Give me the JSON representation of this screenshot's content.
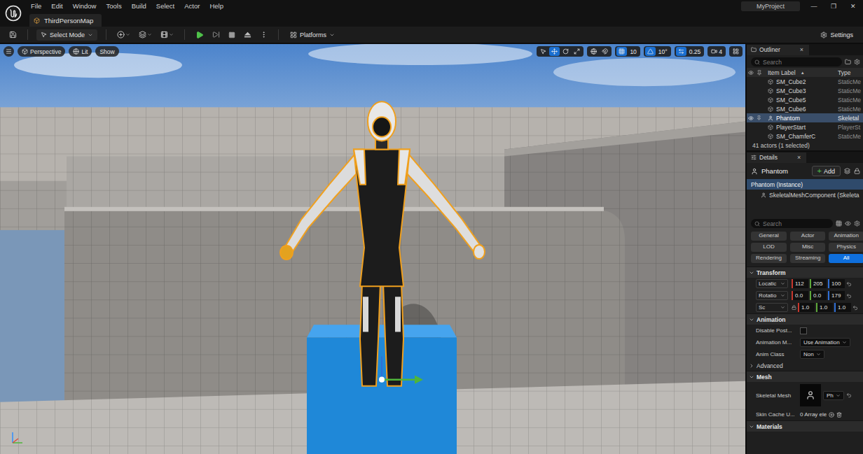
{
  "menu": [
    "File",
    "Edit",
    "Window",
    "Tools",
    "Build",
    "Select",
    "Actor",
    "Help"
  ],
  "level_tab": "ThirdPersonMap",
  "project": "MyProject",
  "window_controls": [
    "—",
    "❐",
    "✕"
  ],
  "toolbar": {
    "mode": "Select Mode",
    "platforms": "Platforms",
    "settings": "Settings"
  },
  "viewport": {
    "view": "Perspective",
    "lighting": "Lit",
    "show": "Show",
    "tools": [
      {
        "kind": "select",
        "selected": false
      },
      {
        "kind": "move",
        "selected": true
      },
      {
        "kind": "rotate",
        "selected": false
      },
      {
        "kind": "scale",
        "selected": false
      }
    ],
    "toggles": [
      {
        "kind": "world",
        "selected": false
      },
      {
        "kind": "surface",
        "selected": false
      }
    ],
    "snaps": [
      {
        "kind": "grid",
        "value": "10",
        "selected": true
      },
      {
        "kind": "angle",
        "value": "10°",
        "selected": true
      },
      {
        "kind": "scale",
        "value": "0.25",
        "selected": true
      }
    ],
    "camera_speed": "4"
  },
  "outliner": {
    "title": "Outliner",
    "close": "×",
    "search_placeholder": "Search",
    "columns": {
      "label": "Item Label",
      "sort": "▲",
      "type": "Type"
    },
    "rows": [
      {
        "label": "SM_Cube2",
        "type": "StaticMe",
        "selected": false
      },
      {
        "label": "SM_Cube3",
        "type": "StaticMe",
        "selected": false
      },
      {
        "label": "SM_Cube5",
        "type": "StaticMe",
        "selected": false
      },
      {
        "label": "SM_Cube6",
        "type": "StaticMe",
        "selected": false
      },
      {
        "label": "Phantom",
        "type": "Skeletal",
        "selected": true
      },
      {
        "label": "PlayerStart",
        "type": "PlayerSt",
        "selected": false
      },
      {
        "label": "SM_ChamferC",
        "type": "StaticMe",
        "selected": false
      }
    ],
    "footer": "41 actors (1 selected)"
  },
  "details": {
    "title": "Details",
    "close": "×",
    "actor": "Phantom",
    "add_icon": "+",
    "add": "Add",
    "components": [
      {
        "label": "Phantom (Instance)",
        "selected": true,
        "kind": "root"
      },
      {
        "label": "SkeletalMeshComponent (Skeleta",
        "selected": false,
        "kind": "child"
      }
    ],
    "search_placeholder": "Search",
    "filters": [
      {
        "label": "General",
        "selected": false
      },
      {
        "label": "Actor",
        "selected": false
      },
      {
        "label": "Animation",
        "selected": false
      },
      {
        "label": "LOD",
        "selected": false
      },
      {
        "label": "Misc",
        "selected": false
      },
      {
        "label": "Physics",
        "selected": false
      },
      {
        "label": "Rendering",
        "selected": false
      },
      {
        "label": "Streaming",
        "selected": false
      },
      {
        "label": "All",
        "selected": true
      }
    ],
    "transform": {
      "title": "Transform",
      "expanded": true,
      "axis_colors": [
        "#c8372d",
        "#5da83a",
        "#2f6fd6"
      ],
      "rows": [
        {
          "kind": "location",
          "label": "Locatic",
          "values": [
            "112",
            "205",
            "100"
          ]
        },
        {
          "kind": "rotation",
          "label": "Rotatio",
          "values": [
            "0.0",
            "0.0",
            "179"
          ]
        },
        {
          "kind": "scale",
          "label": "Sc",
          "values": [
            "1.0",
            "1.0",
            "1.0"
          ]
        }
      ]
    },
    "animation": {
      "title": "Animation",
      "expanded": true,
      "rows": [
        {
          "kind": "checkbox",
          "label": "Disable Post...",
          "checked": false
        },
        {
          "kind": "combo",
          "label": "Animation M...",
          "value": "Use Animation"
        },
        {
          "kind": "combo",
          "label": "Anim Class",
          "value": "Non"
        }
      ]
    },
    "advanced": {
      "title": "Advanced",
      "expanded": false
    },
    "mesh": {
      "title": "Mesh",
      "expanded": true,
      "rows": [
        {
          "kind": "asset",
          "label": "Skeletal Mesh",
          "value": "Ph"
        },
        {
          "kind": "array",
          "label": "Skin Cache U...",
          "value": "0 Array ele"
        }
      ]
    },
    "materials": {
      "title": "Materials",
      "expanded": true
    }
  }
}
